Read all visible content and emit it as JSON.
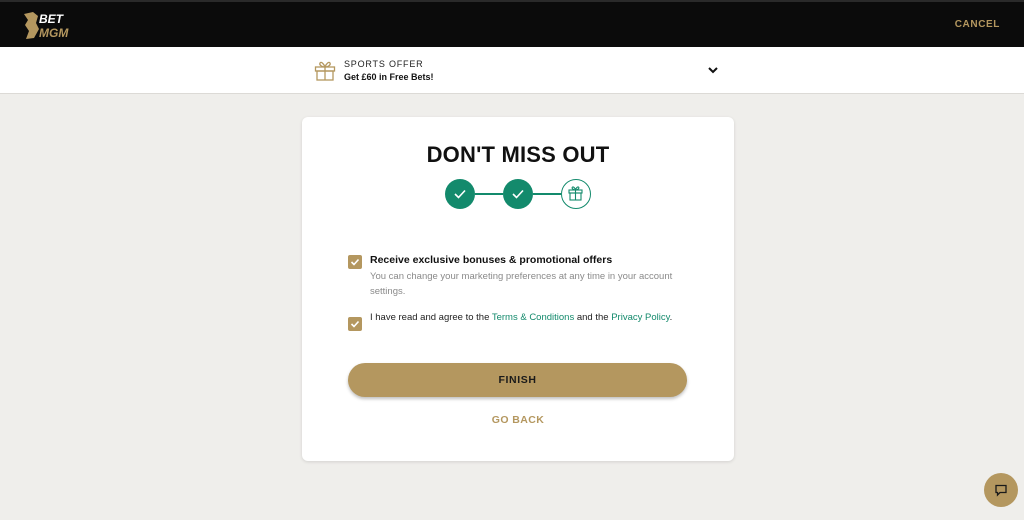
{
  "header": {
    "logo_alt": "BET MGM",
    "cancel_label": "CANCEL"
  },
  "offer": {
    "kicker": "SPORTS OFFER",
    "title": "Get £60 in Free Bets!",
    "icon": "gift-icon",
    "toggle_icon": "chevron-down-icon"
  },
  "card": {
    "title": "DON'T MISS OUT",
    "steps": [
      {
        "state": "done",
        "icon": "check-icon"
      },
      {
        "state": "done",
        "icon": "check-icon"
      },
      {
        "state": "current",
        "icon": "gift-icon"
      }
    ],
    "marketing": {
      "checked": true,
      "title": "Receive exclusive bonuses & promotional offers",
      "subtitle": "You can change your marketing preferences at any time in your account settings."
    },
    "terms": {
      "checked": true,
      "text_before": "I have read and agree to the ",
      "terms_link": "Terms & Conditions",
      "text_middle": " and the ",
      "privacy_link": "Privacy Policy",
      "text_after": "."
    },
    "finish_label": "FINISH",
    "back_label": "GO BACK"
  },
  "chat": {
    "icon": "chat-icon"
  },
  "colors": {
    "gold": "#b4975f",
    "green": "#138a6c",
    "header_bg": "#0b0b0b",
    "page_bg": "#efeeeb"
  }
}
